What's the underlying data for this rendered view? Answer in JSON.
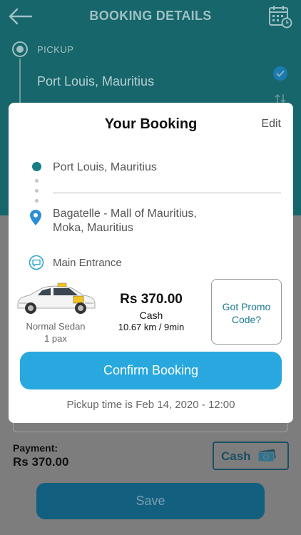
{
  "header": {
    "title": "BOOKING DETAILS",
    "back_icon": "arrow-left-icon",
    "calendar_icon": "calendar-clock-icon"
  },
  "pickup": {
    "label": "PICKUP",
    "value": "Port Louis, Mauritius"
  },
  "booking_card": {
    "title": "Your Booking",
    "edit_label": "Edit",
    "from": "Port Louis, Mauritius",
    "to_line1": "Bagatelle - Mall of Mauritius,",
    "to_line2": "Moka, Mauritius",
    "note": "Main Entrance",
    "vehicle": {
      "type": "Normal Sedan",
      "pax": "1 pax"
    },
    "fare": {
      "price": "Rs 370.00",
      "method": "Cash",
      "distance_time": "10.67 km / 9min"
    },
    "promo_label": "Got Promo Code?",
    "confirm_label": "Confirm Booking",
    "pickup_time": "Pickup time is Feb 14, 2020 - 12:00"
  },
  "payment": {
    "label": "Payment:",
    "amount": "Rs 370.00",
    "method_button": "Cash"
  },
  "save_label": "Save",
  "colors": {
    "header_teal": "#16666b",
    "accent_blue": "#28a8de",
    "dark_blue": "#135f80",
    "promo_text": "#1a7a93"
  }
}
